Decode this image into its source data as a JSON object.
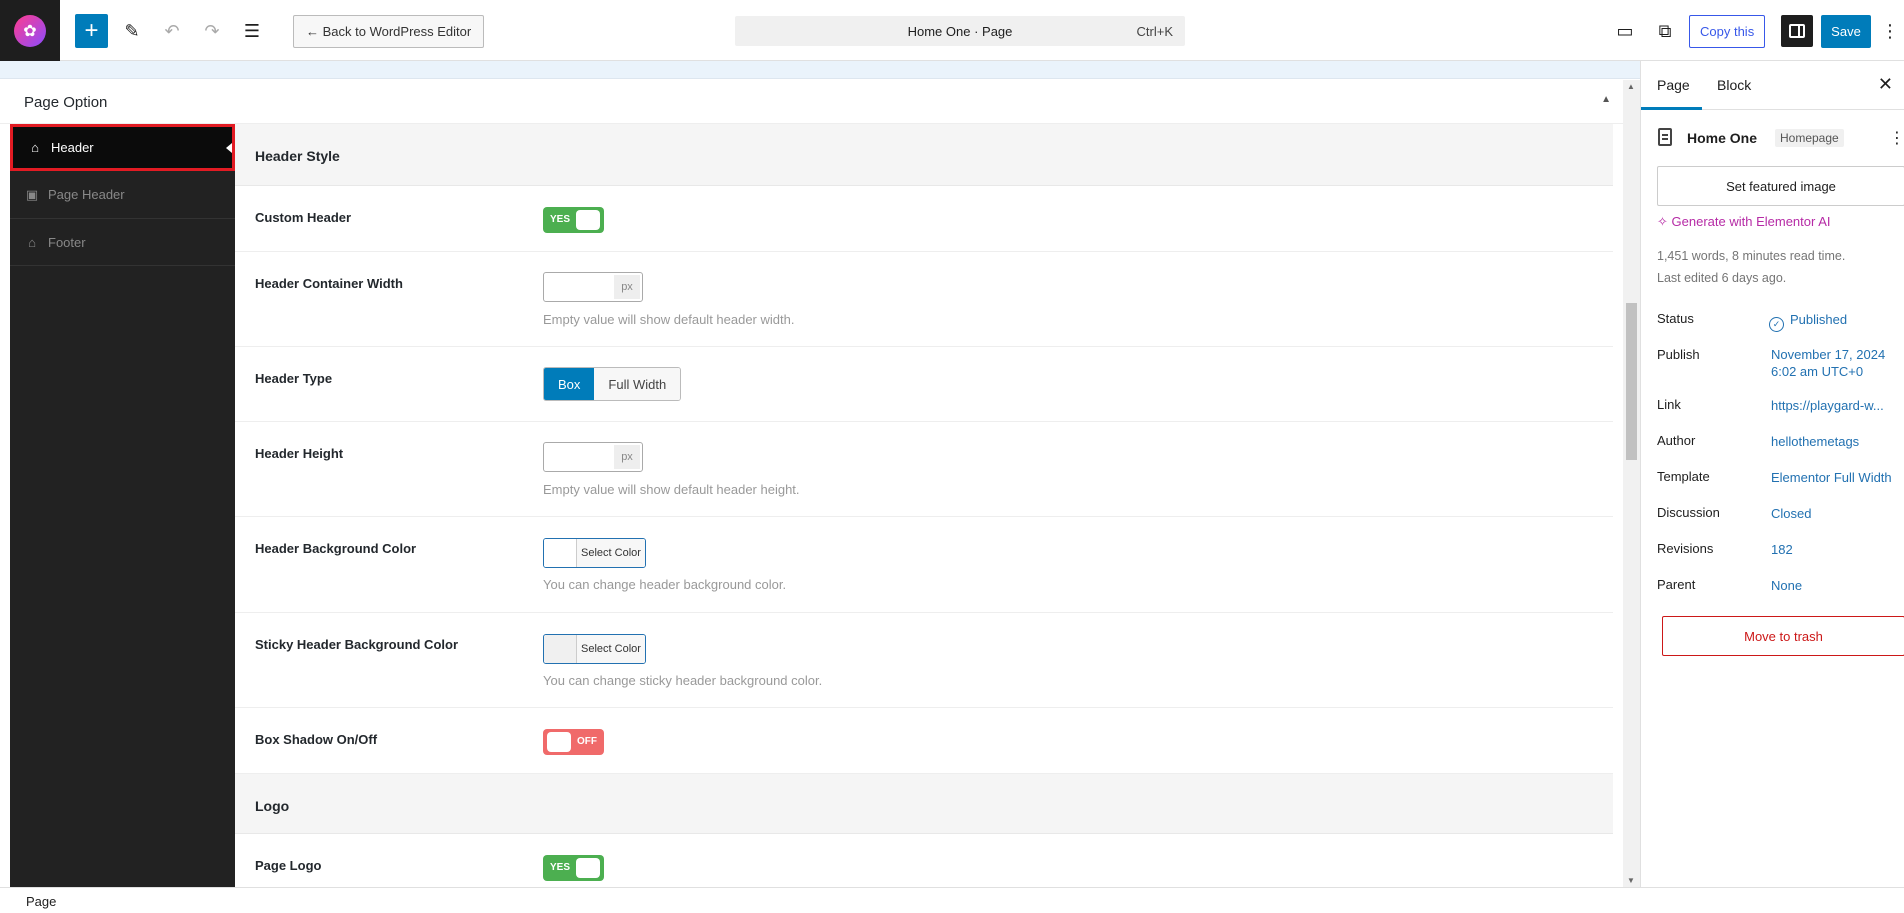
{
  "topbar": {
    "back_label": "← Back to WordPress Editor",
    "command_title": "Home One · Page",
    "command_shortcut": "Ctrl+K",
    "copy_label": "Copy this",
    "save_label": "Save"
  },
  "page_option": {
    "title": "Page Option"
  },
  "side_nav": [
    {
      "label": "Header",
      "icon": "home-icon",
      "active": true
    },
    {
      "label": "Page Header",
      "icon": "image-icon",
      "active": false
    },
    {
      "label": "Footer",
      "icon": "home-icon",
      "active": false
    }
  ],
  "sections": {
    "header_style": "Header Style",
    "logo": "Logo"
  },
  "fields": {
    "custom_header": {
      "label": "Custom Header",
      "state": "YES"
    },
    "container_width": {
      "label": "Header Container Width",
      "unit": "px",
      "hint": "Empty value will show default header width."
    },
    "header_type": {
      "label": "Header Type",
      "options": [
        "Box",
        "Full Width"
      ],
      "selected": "Box"
    },
    "header_height": {
      "label": "Header Height",
      "unit": "px",
      "hint": "Empty value will show default header height."
    },
    "bg_color": {
      "label": "Header Background Color",
      "button": "Select Color",
      "hint": "You can change header background color."
    },
    "sticky_bg_color": {
      "label": "Sticky Header Background Color",
      "button": "Select Color",
      "hint": "You can change sticky header background color."
    },
    "box_shadow": {
      "label": "Box Shadow On/Off",
      "state": "OFF"
    },
    "page_logo": {
      "label": "Page Logo",
      "state": "YES"
    }
  },
  "settings": {
    "tabs": [
      "Page",
      "Block"
    ],
    "post_title": "Home One",
    "post_badge": "Homepage",
    "featured_label": "Set featured image",
    "ai_label": "Generate with Elementor AI",
    "words": "1,451 words, 8 minutes read time.",
    "last_edited": "Last edited 6 days ago.",
    "props": [
      {
        "label": "Status",
        "value": "Published"
      },
      {
        "label": "Publish",
        "value": "November 17, 2024",
        "value2": "6:02 am UTC+0"
      },
      {
        "label": "Link",
        "value": "https://playgard-w..."
      },
      {
        "label": "Author",
        "value": "hellothemetags"
      },
      {
        "label": "Template",
        "value": "Elementor Full Width"
      },
      {
        "label": "Discussion",
        "value": "Closed"
      },
      {
        "label": "Revisions",
        "value": "182"
      },
      {
        "label": "Parent",
        "value": "None"
      }
    ],
    "trash_label": "Move to trash"
  },
  "statusbar": {
    "breadcrumb": "Page"
  },
  "colors": {
    "accent": "#007cba",
    "toggle_on": "#4caf50",
    "toggle_off": "#f06a6a",
    "active_border": "#e21b23",
    "ai": "#b62ba6"
  }
}
